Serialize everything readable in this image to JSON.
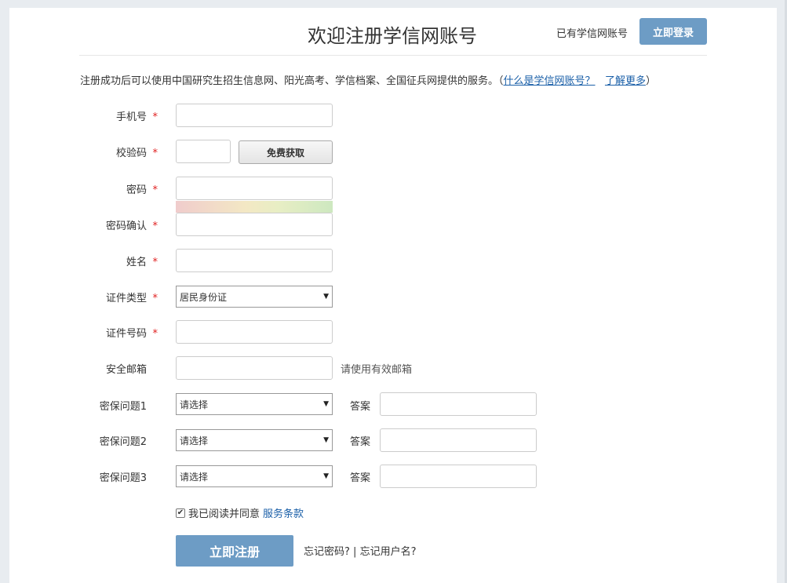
{
  "header": {
    "title": "欢迎注册学信网账号",
    "have_account": "已有学信网账号",
    "login_label": "立即登录"
  },
  "intro": {
    "text": "注册成功后可以使用中国研究生招生信息网、阳光高考、学信档案、全国征兵网提供的服务。（",
    "link1": "什么是学信网账号？",
    "link2": "了解更多",
    "close": "）"
  },
  "form": {
    "required_mark": "*",
    "phone": {
      "label": "手机号",
      "value": ""
    },
    "code": {
      "label": "校验码",
      "value": "",
      "button": "免费获取"
    },
    "password": {
      "label": "密码",
      "value": ""
    },
    "password_confirm": {
      "label": "密码确认",
      "value": ""
    },
    "name": {
      "label": "姓名",
      "value": ""
    },
    "id_type": {
      "label": "证件类型",
      "selected": "居民身份证"
    },
    "id_number": {
      "label": "证件号码",
      "value": ""
    },
    "email": {
      "label": "安全邮箱",
      "value": "",
      "hint": "请使用有效邮箱"
    },
    "security": [
      {
        "label": "密保问题1",
        "selected": "请选择",
        "answer_label": "答案",
        "answer": ""
      },
      {
        "label": "密保问题2",
        "selected": "请选择",
        "answer_label": "答案",
        "answer": ""
      },
      {
        "label": "密保问题3",
        "selected": "请选择",
        "answer_label": "答案",
        "answer": ""
      }
    ],
    "agree_text": "我已阅读并同意",
    "agree_link": "服务条款",
    "agree_checked": true,
    "register_label": "立即注册",
    "forgot_password": "忘记密码?",
    "separator": "|",
    "forgot_username": "忘记用户名?"
  },
  "icons": {
    "select_arrow": "▼",
    "check": "✔"
  }
}
